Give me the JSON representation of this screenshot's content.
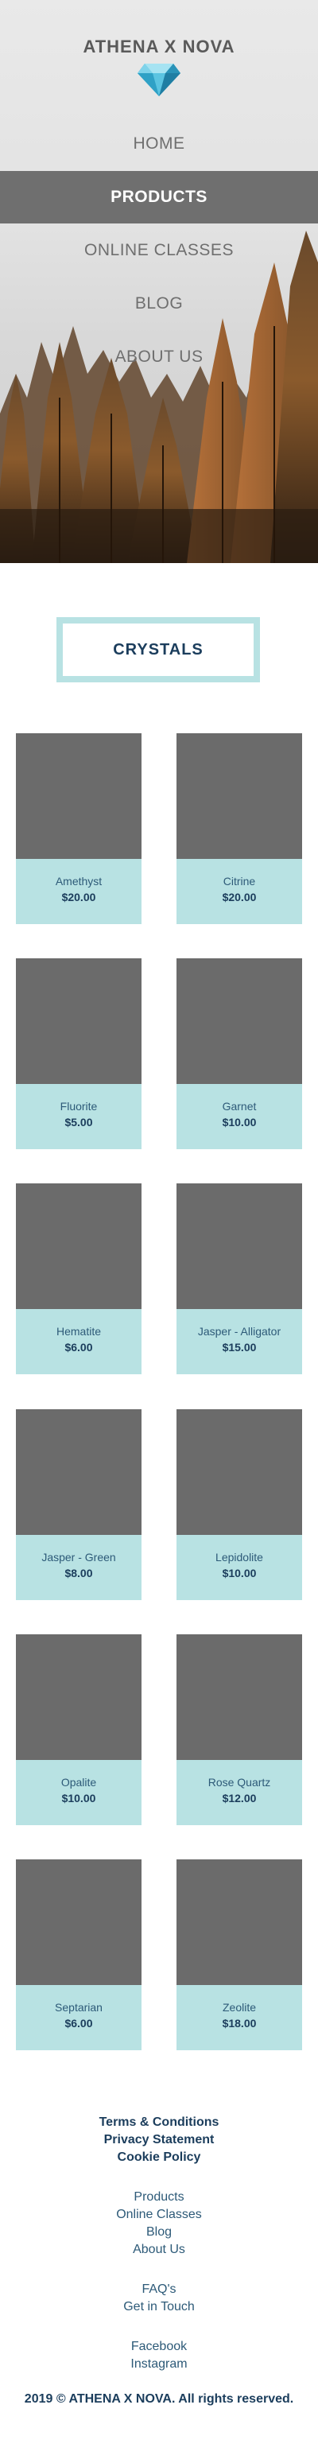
{
  "brand": {
    "name": "ATHENA X NOVA",
    "logo_icon": "diamond-icon"
  },
  "nav": {
    "items": [
      {
        "label": "HOME",
        "active": false
      },
      {
        "label": "PRODUCTS",
        "active": true
      },
      {
        "label": "ONLINE CLASSES",
        "active": false
      },
      {
        "label": "BLOG",
        "active": false
      },
      {
        "label": "ABOUT US",
        "active": false
      }
    ]
  },
  "category": {
    "title": "CRYSTALS"
  },
  "products": [
    {
      "name": "Amethyst",
      "price": "$20.00"
    },
    {
      "name": "Citrine",
      "price": "$20.00"
    },
    {
      "name": "Fluorite",
      "price": "$5.00"
    },
    {
      "name": "Garnet",
      "price": "$10.00"
    },
    {
      "name": "Hematite",
      "price": "$6.00"
    },
    {
      "name": "Jasper - Alligator",
      "price": "$15.00"
    },
    {
      "name": "Jasper - Green",
      "price": "$8.00"
    },
    {
      "name": "Lepidolite",
      "price": "$10.00"
    },
    {
      "name": "Opalite",
      "price": "$10.00"
    },
    {
      "name": "Rose Quartz",
      "price": "$12.00"
    },
    {
      "name": "Septarian",
      "price": "$6.00"
    },
    {
      "name": "Zeolite",
      "price": "$18.00"
    }
  ],
  "footer": {
    "legal": [
      "Terms & Conditions",
      "Privacy Statement",
      "Cookie Policy"
    ],
    "site": [
      "Products",
      "Online Classes",
      "Blog",
      "About Us"
    ],
    "help": [
      "FAQ's",
      "Get in Touch"
    ],
    "social": [
      "Facebook",
      "Instagram"
    ],
    "copyright": "2019  © ATHENA X NOVA. All rights reserved."
  },
  "colors": {
    "accent": "#b8e2e3",
    "text_dark": "#1b3d5c",
    "nav_active_bg": "#6f6f6f",
    "placeholder_image": "#6b6b6b",
    "gem_blue": "#3fb4d6"
  }
}
